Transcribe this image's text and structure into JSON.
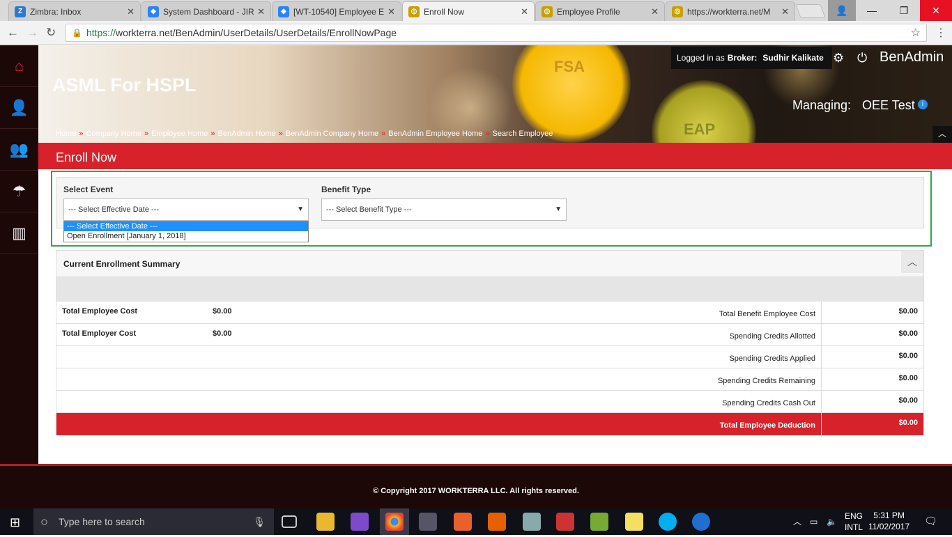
{
  "browser": {
    "tabs": [
      {
        "label": "Zimbra: Inbox",
        "icon": "zimbra-icon",
        "color": "#2a7ad4",
        "glyph": "Z"
      },
      {
        "label": "System Dashboard - JIR",
        "icon": "jira-icon",
        "color": "#2684ff",
        "glyph": "◆"
      },
      {
        "label": "[WT-10540] Employee E",
        "icon": "jira-icon",
        "color": "#2684ff",
        "glyph": "◆"
      },
      {
        "label": "Enroll Now",
        "icon": "workterra-icon",
        "color": "#c8a000",
        "glyph": "◎"
      },
      {
        "label": "Employee Profile",
        "icon": "workterra-icon",
        "color": "#c8a000",
        "glyph": "◎"
      },
      {
        "label": "https://workterra.net/M",
        "icon": "workterra-icon",
        "color": "#c8a000",
        "glyph": "◎"
      }
    ],
    "url_secure": "https://",
    "url_rest": "workterra.net/BenAdmin/UserDetails/UserDetails/EnrollNowPage"
  },
  "header": {
    "company": "ASML For HSPL",
    "logged_prefix": "Logged in as",
    "logged_role": "Broker:",
    "logged_user": "Sudhir Kalikate",
    "app_name": "BenAdmin",
    "managing_label": "Managing:",
    "managing_value": "OEE Test",
    "breadcrumbs": [
      "Home",
      "Company Home",
      "Employee Home",
      "BenAdmin Home",
      "BenAdmin Company Home",
      "BenAdmin Employee Home",
      "Search Employee"
    ],
    "bokeh_labels": [
      "FSA",
      "EAP"
    ]
  },
  "page": {
    "title": "Enroll Now",
    "select_event_label": "Select Event",
    "select_event_value": "--- Select Effective Date ---",
    "benefit_type_label": "Benefit Type",
    "benefit_type_value": "--- Select Benefit Type ---",
    "event_options": [
      "--- Select Effective Date ---",
      "Open Enrollment [January 1, 2018]"
    ]
  },
  "summary": {
    "title": "Current Enrollment Summary",
    "left_rows": [
      {
        "label": "Total Employee Cost",
        "value": "$0.00"
      },
      {
        "label": "Total Employer Cost",
        "value": "$0.00"
      }
    ],
    "right_rows": [
      {
        "label": "Total Benefit Employee Cost",
        "value": "$0.00"
      },
      {
        "label": "Spending Credits Allotted",
        "value": "$0.00"
      },
      {
        "label": "Spending Credits Applied",
        "value": "$0.00"
      },
      {
        "label": "Spending Credits Remaining",
        "value": "$0.00"
      },
      {
        "label": "Spending Credits Cash Out",
        "value": "$0.00"
      }
    ],
    "total_label": "Total Employee Deduction",
    "total_value": "$0.00"
  },
  "footer": {
    "copyright": "© Copyright 2017 WORKTERRA LLC. All rights reserved."
  },
  "taskbar": {
    "search_placeholder": "Type here to search",
    "lang1": "ENG",
    "lang2": "INTL",
    "time": "5:31 PM",
    "date": "11/02/2017"
  },
  "colors": {
    "brand_red": "#d8222b",
    "sidebar_dark": "#1d0808",
    "highlight_green": "#2ea84a",
    "selected_option": "#1e90ff"
  }
}
